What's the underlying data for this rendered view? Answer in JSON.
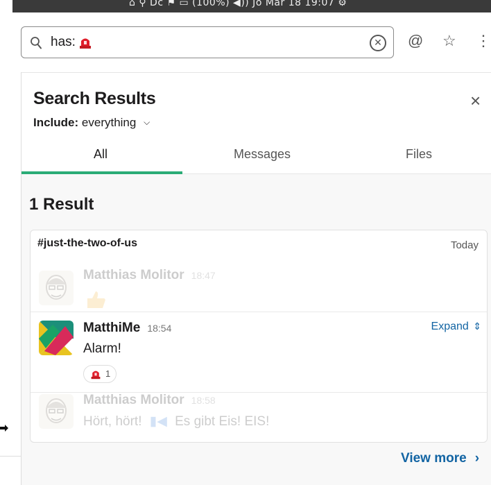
{
  "system_bar": {
    "text": "⌂  ⚲  Dc  ⚑  ▭ (100%)  ◀))  Jo Mar 18 19:07  ⚙"
  },
  "search": {
    "query": "has:",
    "query_emoji": "rotating-light-icon",
    "clear_icon": "clear-circle-icon"
  },
  "header_icons": {
    "mentions": "@",
    "star": "☆",
    "more": "⋮"
  },
  "panel": {
    "title": "Search Results",
    "include_label": "Include:",
    "include_value": "everything",
    "close": "×"
  },
  "tabs": [
    {
      "label": "All",
      "active": true
    },
    {
      "label": "Messages",
      "active": false
    },
    {
      "label": "Files",
      "active": false
    }
  ],
  "result_count": "1 Result",
  "result_card": {
    "channel": "#just-the-two-of-us",
    "date": "Today",
    "messages": [
      {
        "author": "Matthias Molitor",
        "time": "18:47",
        "body": "",
        "reaction": "thumbs-up-icon",
        "faded": true
      },
      {
        "author": "MatthiMe",
        "time": "18:54",
        "body": "Alarm!",
        "reaction_count": "1",
        "expand": "Expand",
        "faded": false
      },
      {
        "author": "Matthias Molitor",
        "time": "18:58",
        "body_a": "Hört, hört!",
        "body_b": "Es gibt Eis! EIS!",
        "faded": true
      }
    ]
  },
  "view_more": "View more",
  "colors": {
    "accent_green": "#2bac76",
    "link_blue": "#1264a3",
    "siren_red": "#e01e2b"
  }
}
